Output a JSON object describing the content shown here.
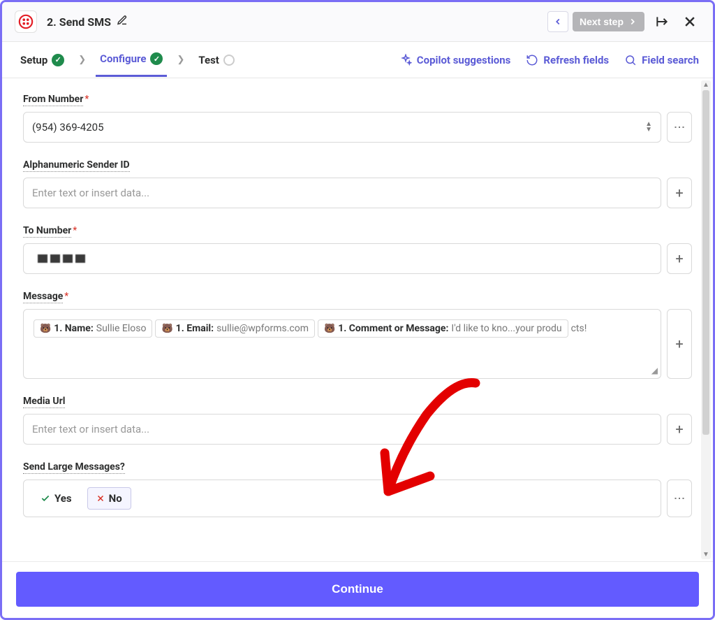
{
  "header": {
    "step_title": "2. Send SMS",
    "next_label": "Next step"
  },
  "tabs": {
    "setup": "Setup",
    "configure": "Configure",
    "test": "Test"
  },
  "actions": {
    "copilot": "Copilot suggestions",
    "refresh": "Refresh fields",
    "search": "Field search"
  },
  "fields": {
    "from_number": {
      "label": "From Number",
      "value": "(954) 369-4205"
    },
    "alpha_sender": {
      "label": "Alphanumeric Sender ID",
      "placeholder": "Enter text or insert data..."
    },
    "to_number": {
      "label": "To Number"
    },
    "message": {
      "label": "Message",
      "pills": [
        {
          "label": "1. Name:",
          "value": "Sullie Eloso"
        },
        {
          "label": "1. Email:",
          "value": "sullie@wpforms.com"
        },
        {
          "label": "1. Comment or Message:",
          "value": "I'd like to kno...your produ"
        }
      ],
      "trail": "cts!"
    },
    "media_url": {
      "label": "Media Url",
      "placeholder": "Enter text or insert data..."
    },
    "send_large": {
      "label": "Send Large Messages?",
      "yes": "Yes",
      "no": "No"
    }
  },
  "footer": {
    "continue": "Continue"
  }
}
